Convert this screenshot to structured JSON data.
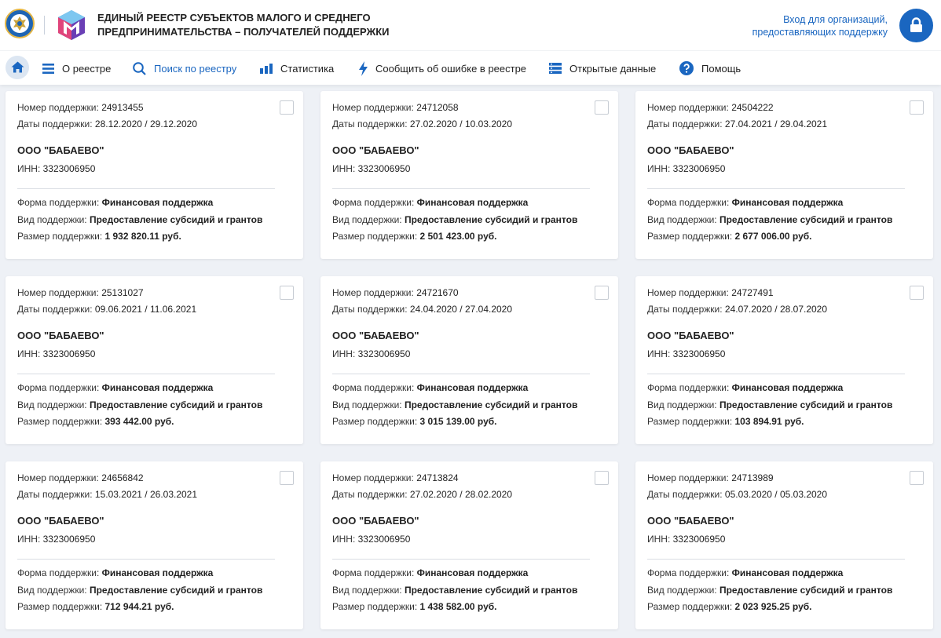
{
  "header": {
    "title_line1": "ЕДИНЫЙ РЕЕСТР СУБЪЕКТОВ МАЛОГО И СРЕДНЕГО",
    "title_line2": "ПРЕДПРИНИМАТЕЛЬСТВА – ПОЛУЧАТЕЛЕЙ ПОДДЕРЖКИ",
    "login_line1": "Вход для организаций,",
    "login_line2": "предоставляющих поддержку",
    "accent_color": "#1a66c0"
  },
  "nav": {
    "items": [
      {
        "label": "О реестре",
        "icon": "list-icon"
      },
      {
        "label": "Поиск по реестру",
        "icon": "search-icon",
        "active": true
      },
      {
        "label": "Статистика",
        "icon": "bar-chart-icon"
      },
      {
        "label": "Сообщить об ошибке в реестре",
        "icon": "lightning-icon"
      },
      {
        "label": "Открытые данные",
        "icon": "database-icon"
      },
      {
        "label": "Помощь",
        "icon": "help-icon"
      }
    ]
  },
  "labels": {
    "number": "Номер поддержки: ",
    "dates": "Даты поддержки: ",
    "inn": "ИНН: ",
    "form": "Форма поддержки: ",
    "kind": "Вид поддержки: ",
    "size": "Размер поддержки: "
  },
  "cards": [
    {
      "number": "24913455",
      "dates": "28.12.2020 / 29.12.2020",
      "org": "ООО \"БАБАЕВО\"",
      "inn": "3323006950",
      "form": "Финансовая поддержка",
      "kind": "Предоставление субсидий и грантов",
      "size": "1 932 820.11 руб."
    },
    {
      "number": "24712058",
      "dates": "27.02.2020 / 10.03.2020",
      "org": "ООО \"БАБАЕВО\"",
      "inn": "3323006950",
      "form": "Финансовая поддержка",
      "kind": "Предоставление субсидий и грантов",
      "size": "2 501 423.00 руб."
    },
    {
      "number": "24504222",
      "dates": "27.04.2021 / 29.04.2021",
      "org": "ООО \"БАБАЕВО\"",
      "inn": "3323006950",
      "form": "Финансовая поддержка",
      "kind": "Предоставление субсидий и грантов",
      "size": "2 677 006.00 руб."
    },
    {
      "number": "25131027",
      "dates": "09.06.2021 / 11.06.2021",
      "org": "ООО \"БАБАЕВО\"",
      "inn": "3323006950",
      "form": "Финансовая поддержка",
      "kind": "Предоставление субсидий и грантов",
      "size": "393 442.00 руб."
    },
    {
      "number": "24721670",
      "dates": "24.04.2020 / 27.04.2020",
      "org": "ООО \"БАБАЕВО\"",
      "inn": "3323006950",
      "form": "Финансовая поддержка",
      "kind": "Предоставление субсидий и грантов",
      "size": "3 015 139.00 руб."
    },
    {
      "number": "24727491",
      "dates": "24.07.2020 / 28.07.2020",
      "org": "ООО \"БАБАЕВО\"",
      "inn": "3323006950",
      "form": "Финансовая поддержка",
      "kind": "Предоставление субсидий и грантов",
      "size": "103 894.91 руб."
    },
    {
      "number": "24656842",
      "dates": "15.03.2021 / 26.03.2021",
      "org": "ООО \"БАБАЕВО\"",
      "inn": "3323006950",
      "form": "Финансовая поддержка",
      "kind": "Предоставление субсидий и грантов",
      "size": "712 944.21 руб."
    },
    {
      "number": "24713824",
      "dates": "27.02.2020 / 28.02.2020",
      "org": "ООО \"БАБАЕВО\"",
      "inn": "3323006950",
      "form": "Финансовая поддержка",
      "kind": "Предоставление субсидий и грантов",
      "size": "1 438 582.00 руб."
    },
    {
      "number": "24713989",
      "dates": "05.03.2020 / 05.03.2020",
      "org": "ООО \"БАБАЕВО\"",
      "inn": "3323006950",
      "form": "Финансовая поддержка",
      "kind": "Предоставление субсидий и грантов",
      "size": "2 023 925.25 руб."
    }
  ]
}
